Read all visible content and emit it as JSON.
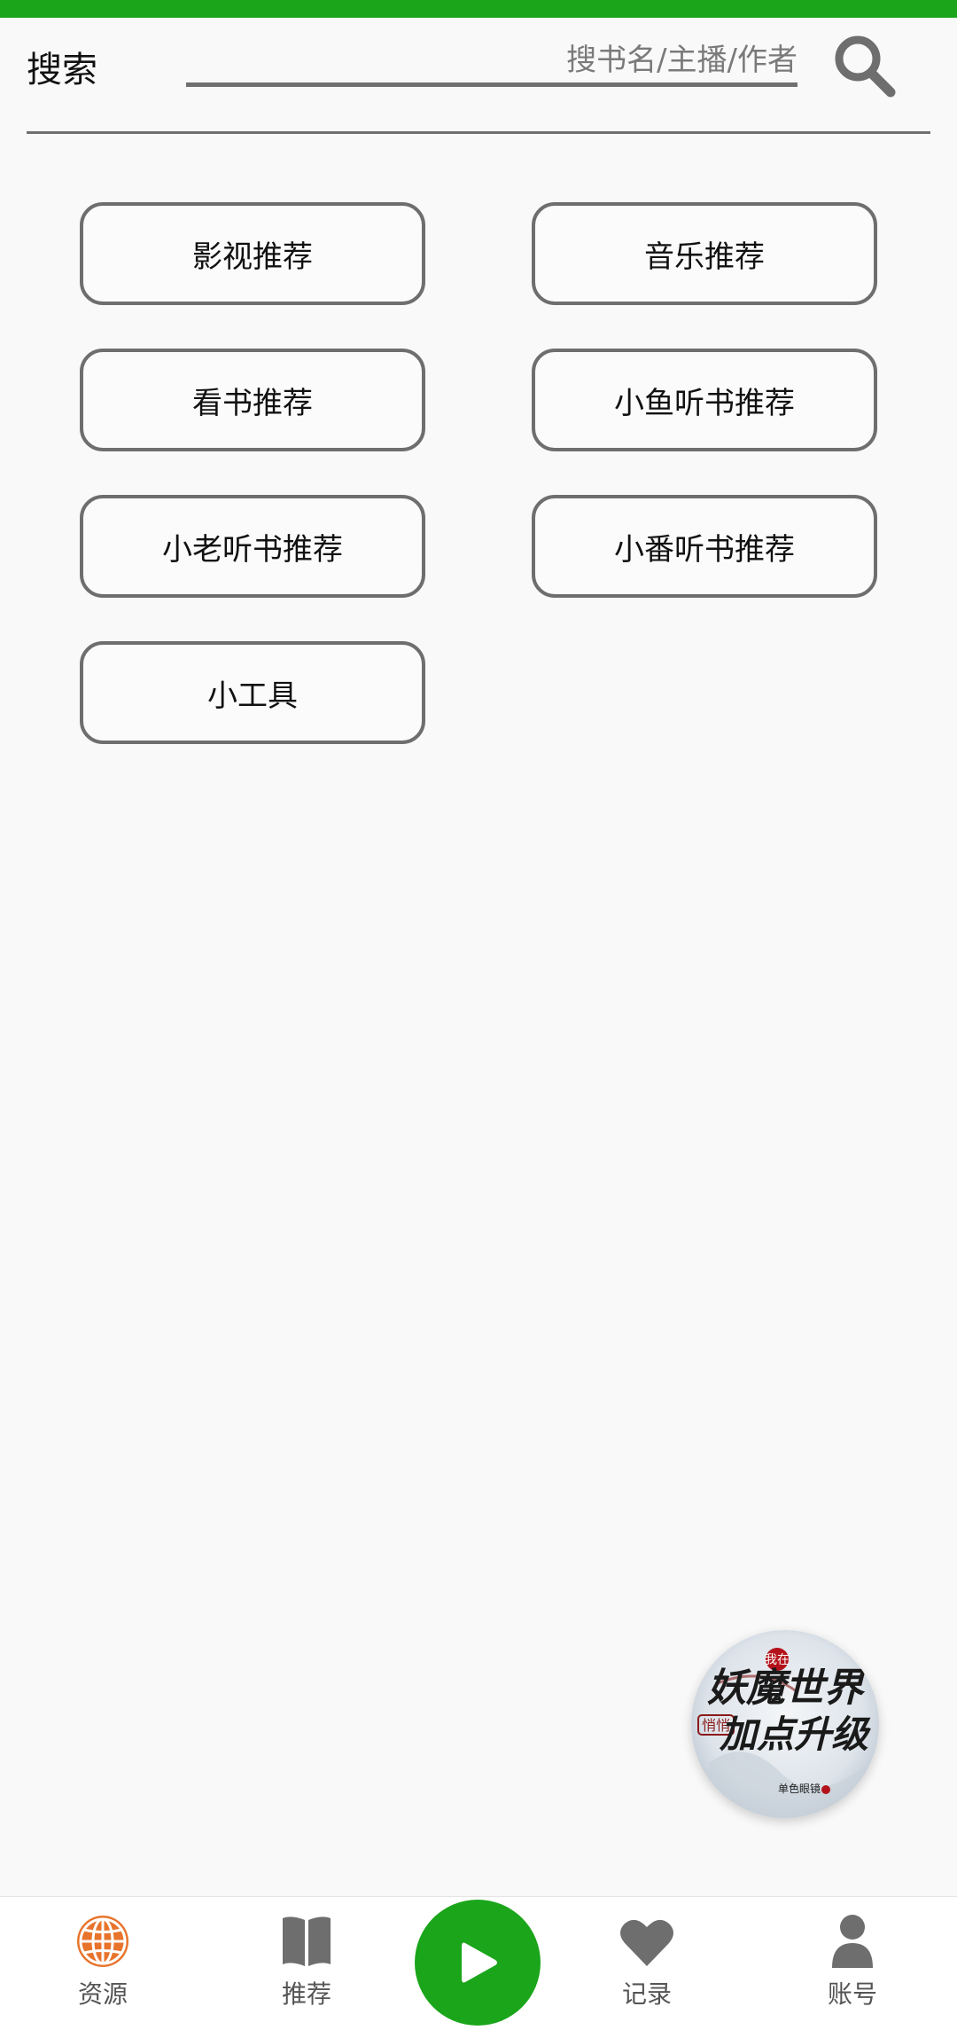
{
  "search": {
    "label": "搜索",
    "placeholder": "搜书名/主播/作者"
  },
  "recommendations": [
    {
      "label": "影视推荐"
    },
    {
      "label": "音乐推荐"
    },
    {
      "label": "看书推荐"
    },
    {
      "label": "小鱼听书推荐"
    },
    {
      "label": "小老听书推荐"
    },
    {
      "label": "小番听书推荐"
    },
    {
      "label": "小工具"
    }
  ],
  "now_playing": {
    "cover_text_small": "我在",
    "cover_line_1": "妖魔世界",
    "cover_tag": "悄悄",
    "cover_line_2": "加点升级",
    "cover_author": "单色眼镜"
  },
  "bottom_nav": [
    {
      "label": "资源",
      "icon": "globe-icon"
    },
    {
      "label": "推荐",
      "icon": "book-icon"
    },
    {
      "label": "记录",
      "icon": "heart-icon"
    },
    {
      "label": "账号",
      "icon": "person-icon"
    }
  ],
  "colors": {
    "accent_green": "#1aa51a",
    "active_orange": "#e8742c",
    "icon_gray": "#6e6e6e"
  }
}
